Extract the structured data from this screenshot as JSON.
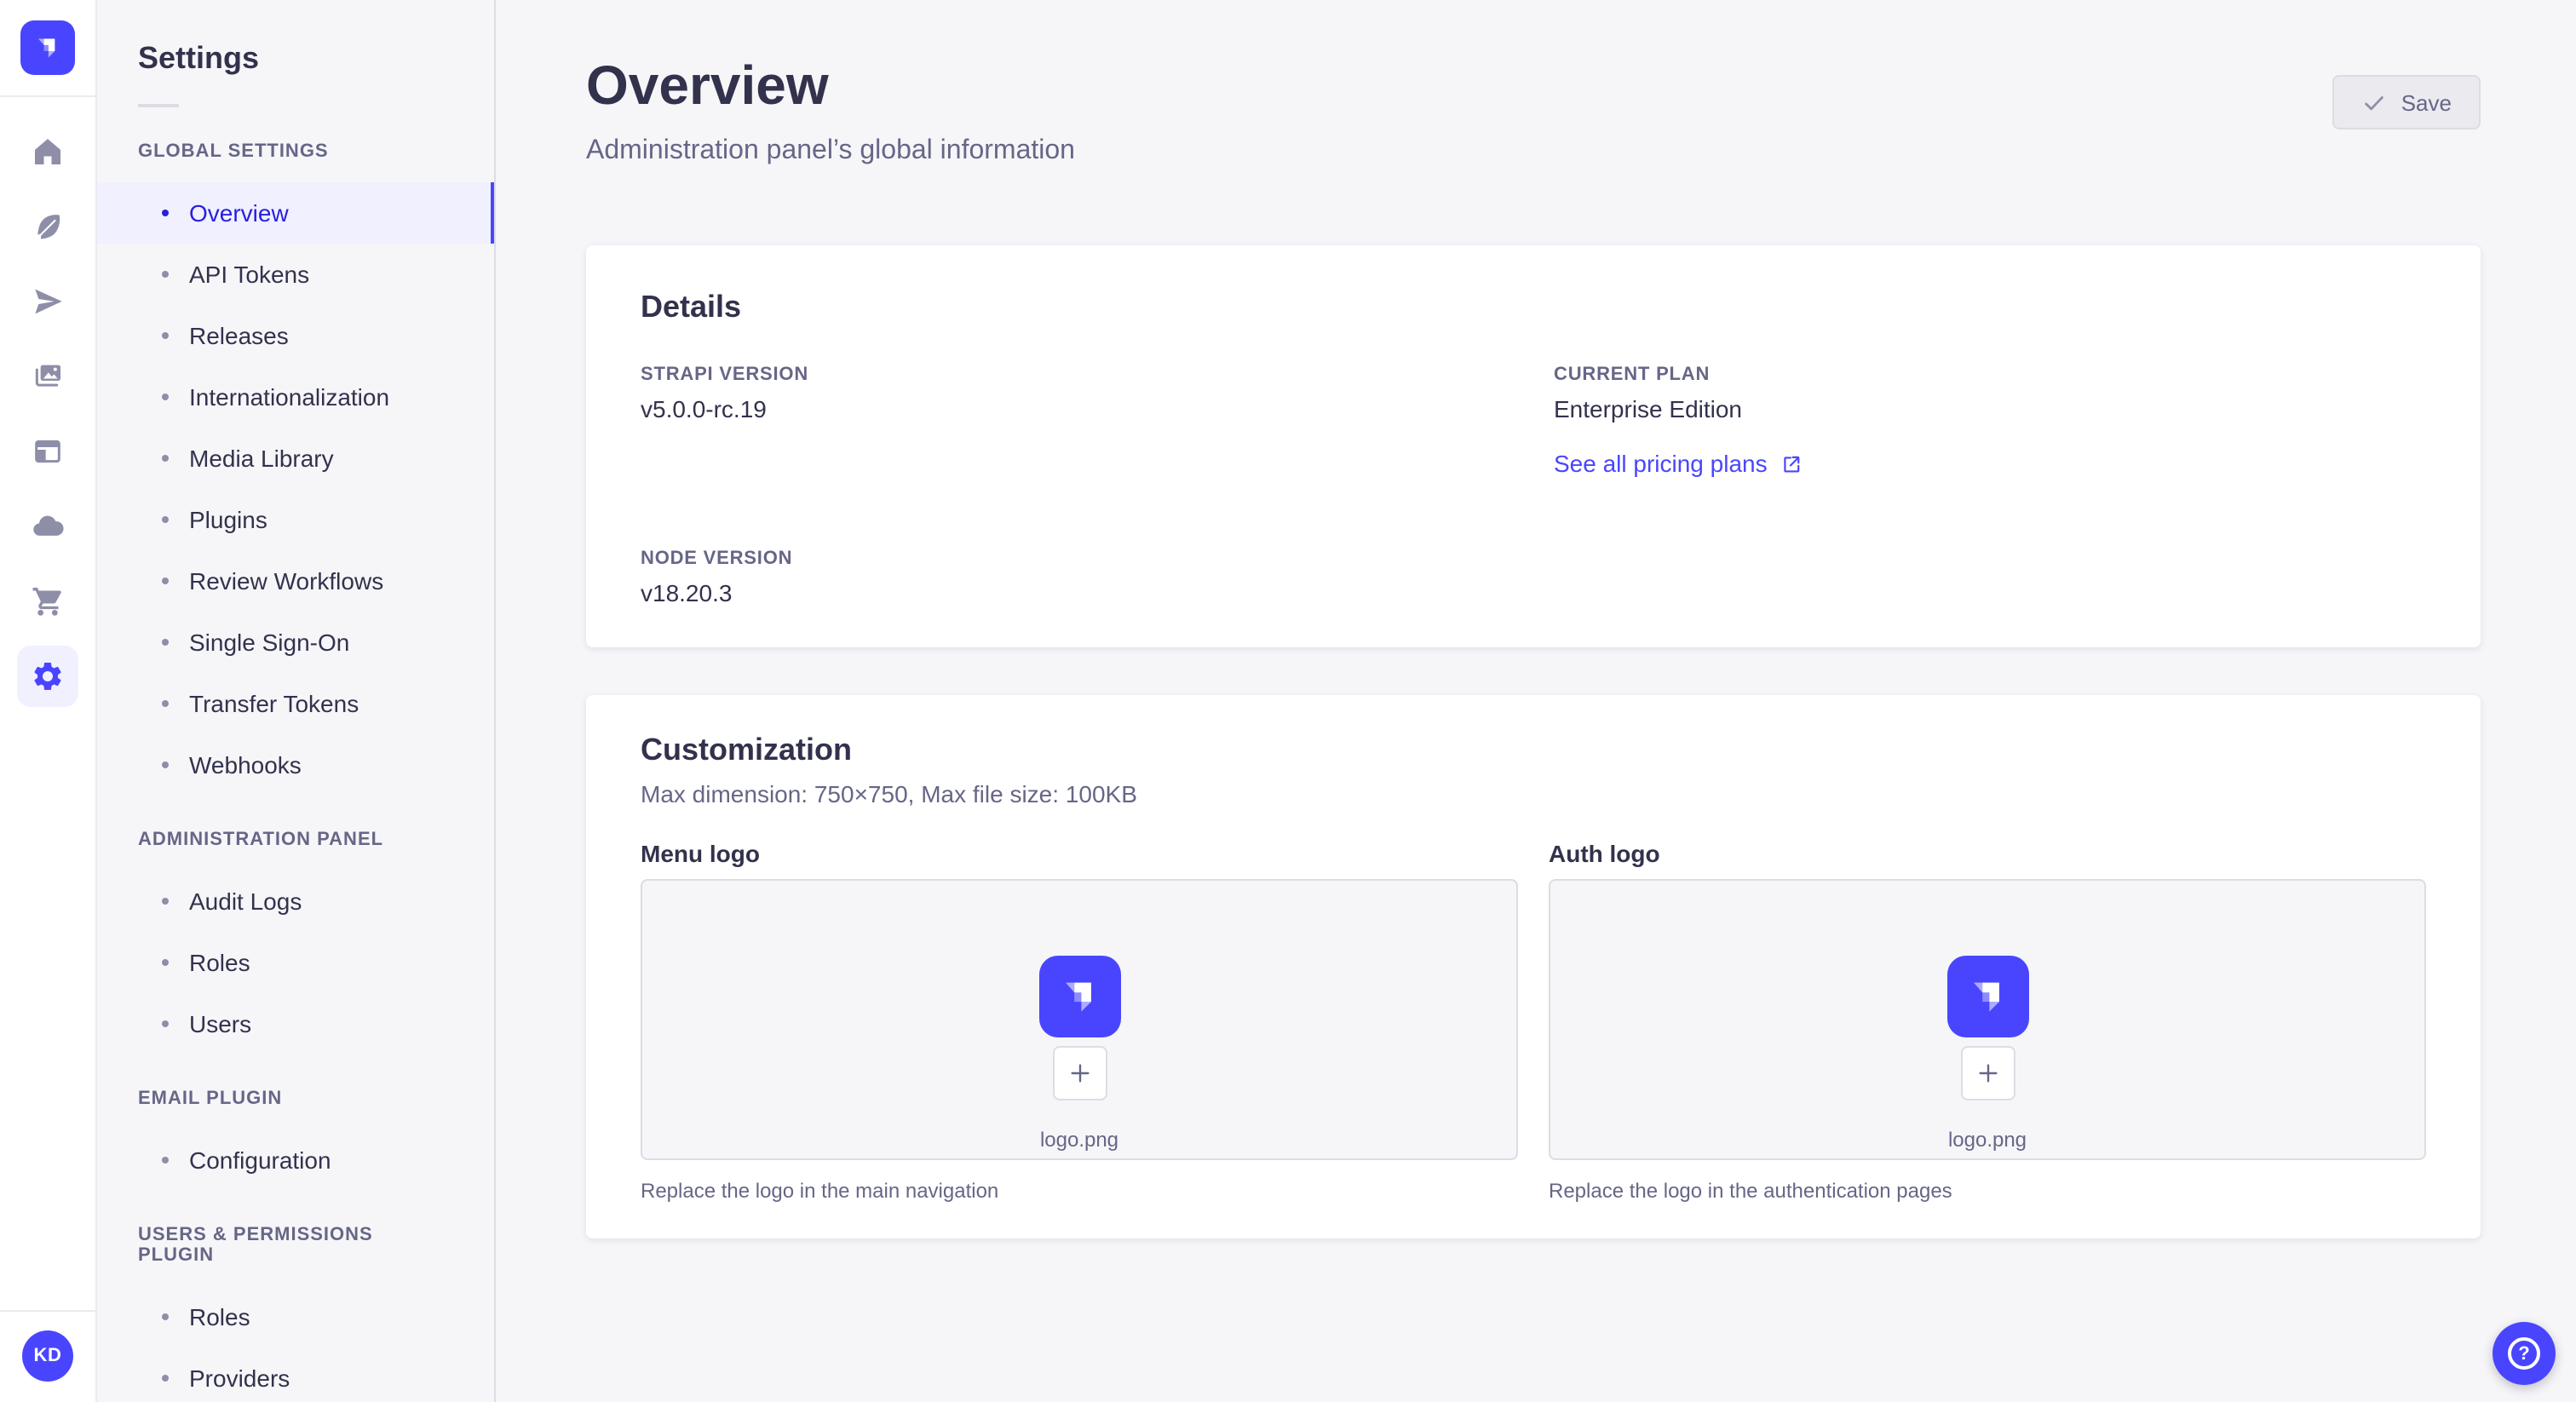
{
  "colors": {
    "primary": "#4945ff",
    "primary_active_text": "#271fe0",
    "primary_light_bg": "#f0f0ff",
    "text": "#32324d",
    "text_muted": "#666687"
  },
  "main_nav": {
    "logo_icon": "strapi-logo",
    "items": [
      {
        "icon": "home-icon"
      },
      {
        "icon": "feather-icon"
      },
      {
        "icon": "paper-plane-icon"
      },
      {
        "icon": "media-library-icon"
      },
      {
        "icon": "layout-icon"
      },
      {
        "icon": "cloud-icon"
      },
      {
        "icon": "cart-icon"
      },
      {
        "icon": "gear-icon",
        "active": true
      }
    ],
    "user_initials": "KD"
  },
  "settings_nav": {
    "title": "Settings",
    "sections": [
      {
        "label": "GLOBAL SETTINGS",
        "items": [
          {
            "label": "Overview",
            "active": true
          },
          {
            "label": "API Tokens"
          },
          {
            "label": "Releases"
          },
          {
            "label": "Internationalization"
          },
          {
            "label": "Media Library"
          },
          {
            "label": "Plugins"
          },
          {
            "label": "Review Workflows"
          },
          {
            "label": "Single Sign-On"
          },
          {
            "label": "Transfer Tokens"
          },
          {
            "label": "Webhooks"
          }
        ]
      },
      {
        "label": "ADMINISTRATION PANEL",
        "items": [
          {
            "label": "Audit Logs"
          },
          {
            "label": "Roles"
          },
          {
            "label": "Users"
          }
        ]
      },
      {
        "label": "EMAIL PLUGIN",
        "items": [
          {
            "label": "Configuration"
          }
        ]
      },
      {
        "label": "USERS & PERMISSIONS PLUGIN",
        "items": [
          {
            "label": "Roles"
          },
          {
            "label": "Providers"
          }
        ]
      }
    ]
  },
  "header": {
    "title": "Overview",
    "subtitle": "Administration panel’s global information",
    "save_label": "Save"
  },
  "details_card": {
    "title": "Details",
    "strapi_version": {
      "label": "STRAPI VERSION",
      "value": "v5.0.0-rc.19"
    },
    "current_plan": {
      "label": "CURRENT PLAN",
      "value": "Enterprise Edition"
    },
    "node_version": {
      "label": "NODE VERSION",
      "value": "v18.20.3"
    },
    "pricing_link": "See all pricing plans"
  },
  "customization_card": {
    "title": "Customization",
    "subtitle": "Max dimension: 750×750, Max file size: 100KB",
    "menu_logo": {
      "label": "Menu logo",
      "file_name": "logo.png",
      "hint": "Replace the logo in the main navigation"
    },
    "auth_logo": {
      "label": "Auth logo",
      "file_name": "logo.png",
      "hint": "Replace the logo in the authentication pages"
    }
  },
  "help": {
    "icon": "question-mark-icon"
  }
}
